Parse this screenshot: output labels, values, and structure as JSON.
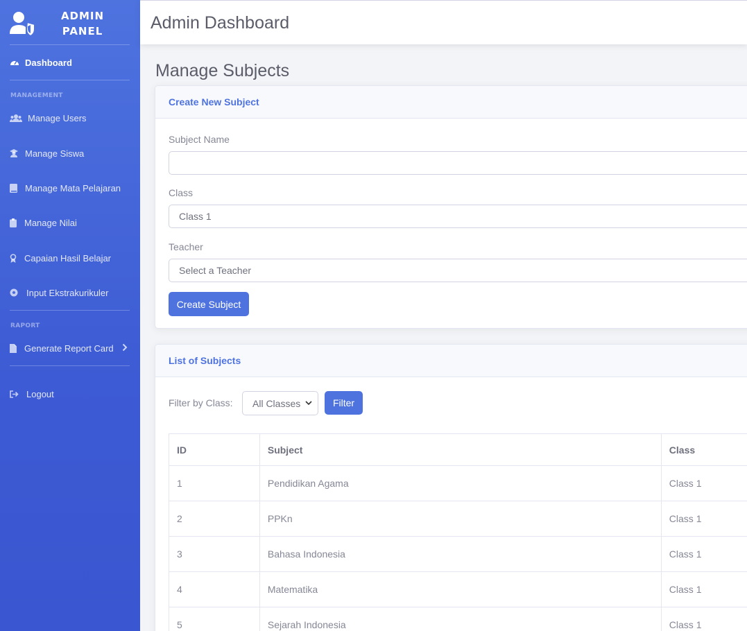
{
  "brand": {
    "line1": "ADMIN",
    "line2": "PANEL"
  },
  "sidebar": {
    "dashboard": "Dashboard",
    "heading_management": "MANAGEMENT",
    "items": [
      {
        "label": "Manage Users",
        "icon": "users-icon"
      },
      {
        "label": "Manage Siswa",
        "icon": "student-icon"
      },
      {
        "label": "Manage Mata Pelajaran",
        "icon": "book-icon"
      },
      {
        "label": "Manage Nilai",
        "icon": "clipboard-icon"
      },
      {
        "label": "Capaian Hasil Belajar",
        "icon": "award-icon"
      },
      {
        "label": "Input Ekstrakurikuler",
        "icon": "ball-icon"
      }
    ],
    "heading_raport": "RAPORT",
    "report": "Generate Report Card",
    "logout": "Logout"
  },
  "topbar": {
    "title": "Admin Dashboard"
  },
  "page": {
    "title": "Manage Subjects"
  },
  "create_card": {
    "header": "Create New Subject",
    "subject_name_label": "Subject Name",
    "subject_name_value": "",
    "class_label": "Class",
    "class_value": "Class 1",
    "teacher_label": "Teacher",
    "teacher_value": "Select a Teacher",
    "submit": "Create Subject"
  },
  "list_card": {
    "header": "List of Subjects",
    "filter_label": "Filter by Class:",
    "filter_value": "All Classes",
    "filter_button": "Filter",
    "columns": [
      "ID",
      "Subject",
      "Class"
    ],
    "rows": [
      [
        "1",
        "Pendidikan Agama",
        "Class 1"
      ],
      [
        "2",
        "PPKn",
        "Class 1"
      ],
      [
        "3",
        "Bahasa Indonesia",
        "Class 1"
      ],
      [
        "4",
        "Matematika",
        "Class 1"
      ],
      [
        "5",
        "Sejarah Indonesia",
        "Class 1"
      ]
    ]
  },
  "colors": {
    "primary": "#4e73df",
    "sidebar_end": "#3a56d0",
    "text_muted": "#858796"
  }
}
